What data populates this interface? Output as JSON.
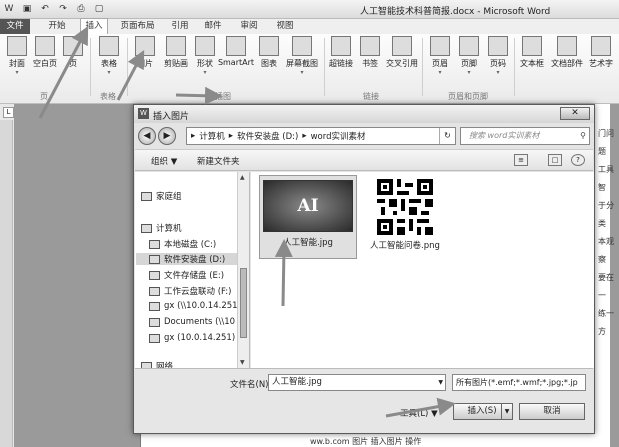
{
  "window": {
    "title": "人工智能技术科普简报.docx - Microsoft Word"
  },
  "tabs": [
    "文件",
    "开始",
    "插入",
    "页面布局",
    "引用",
    "邮件",
    "审阅",
    "视图"
  ],
  "ribbon": {
    "buttons": [
      {
        "label": "封面",
        "icon": "cover-page-icon"
      },
      {
        "label": "空白页",
        "icon": "blank-page-icon"
      },
      {
        "label": "页",
        "icon": "page-break-icon"
      },
      {
        "label": "表格",
        "icon": "table-icon"
      },
      {
        "label": "图片",
        "icon": "picture-icon"
      },
      {
        "label": "剪贴画",
        "icon": "clipart-icon"
      },
      {
        "label": "形状",
        "icon": "shapes-icon"
      },
      {
        "label": "SmartArt",
        "icon": "smartart-icon"
      },
      {
        "label": "图表",
        "icon": "chart-icon"
      },
      {
        "label": "屏幕截图",
        "icon": "screenshot-icon"
      },
      {
        "label": "超链接",
        "icon": "hyperlink-icon"
      },
      {
        "label": "书签",
        "icon": "bookmark-icon"
      },
      {
        "label": "交叉引用",
        "icon": "cross-reference-icon"
      },
      {
        "label": "页眉",
        "icon": "header-icon"
      },
      {
        "label": "页脚",
        "icon": "footer-icon"
      },
      {
        "label": "页码",
        "icon": "page-number-icon"
      },
      {
        "label": "文本框",
        "icon": "textbox-icon"
      },
      {
        "label": "文档部件",
        "icon": "quick-parts-icon"
      },
      {
        "label": "艺术字",
        "icon": "wordart-icon"
      }
    ],
    "groups": [
      "页",
      "表格",
      "插图",
      "链接",
      "页眉和页脚"
    ]
  },
  "ruler_tab": "L",
  "document": {
    "side_text": [
      "门问题",
      "工具智",
      "于分类",
      "本观察",
      "要在一",
      "练一方"
    ],
    "bottom_text": "ww.b.com 图片 插入图片 操作"
  },
  "dialog": {
    "title": "插入图片",
    "close": "✕",
    "breadcrumb": [
      "计算机",
      "软件安装盘 (D:)",
      "word实训素材"
    ],
    "search_placeholder": "搜索 word实训素材",
    "organize": "组织 ▼",
    "new_folder": "新建文件夹",
    "nav_items": [
      {
        "label": "家庭组",
        "icon": "homegroup-icon"
      },
      {
        "label": "计算机",
        "icon": "computer-icon"
      },
      {
        "label": "本地磁盘 (C:)",
        "icon": "drive-c-icon"
      },
      {
        "label": "软件安装盘 (D:)",
        "icon": "drive-d-icon",
        "selected": true
      },
      {
        "label": "文件存储盘 (E:)",
        "icon": "drive-e-icon"
      },
      {
        "label": "工作云盘联动 (F:)",
        "icon": "drive-f-icon"
      },
      {
        "label": "gx (\\\\10.0.14.251",
        "icon": "network-drive-icon"
      },
      {
        "label": "Documents (\\\\10",
        "icon": "network-folder-icon"
      },
      {
        "label": "gx (10.0.14.251)",
        "icon": "network-drive-icon"
      },
      {
        "label": "网络",
        "icon": "network-icon"
      }
    ],
    "files": [
      {
        "name": "人工智能.jpg",
        "thumb_text": "AI",
        "selected": true
      },
      {
        "name": "人工智能问卷.png",
        "thumb_text": ""
      }
    ],
    "filename_label": "文件名(N):",
    "filename_value": "人工智能.jpg",
    "filter_value": "所有图片(*.emf;*.wmf;*.jpg;*.jp",
    "tools": "工具(L) ▼",
    "insert": "插入(S)",
    "cancel": "取消"
  }
}
